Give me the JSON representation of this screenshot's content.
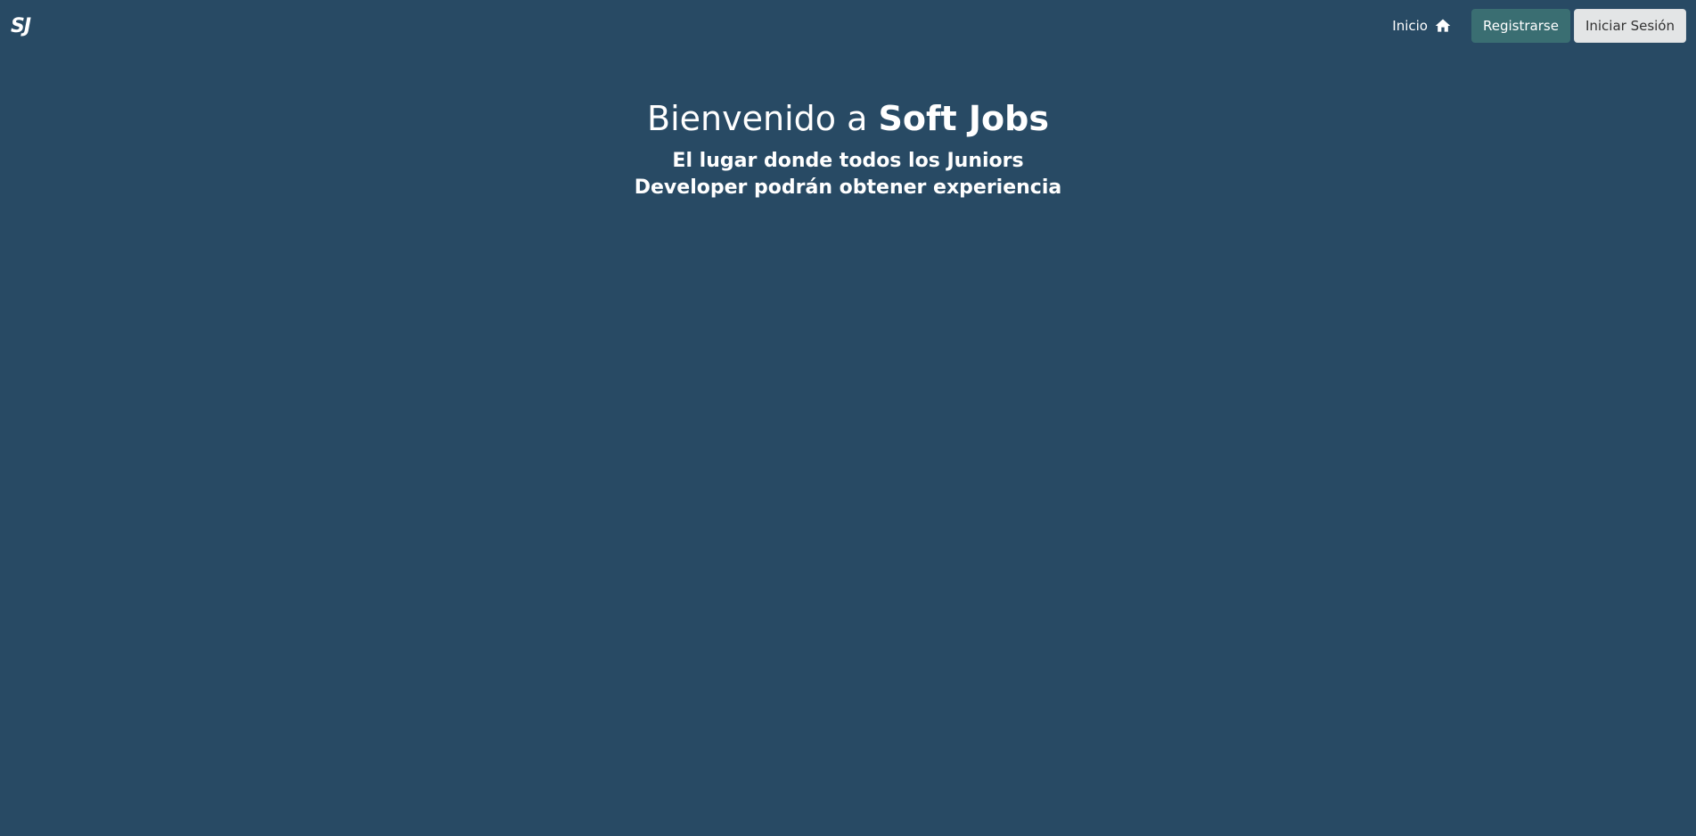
{
  "navbar": {
    "brand": "SJ",
    "home_label": "Inicio",
    "home_icon": "home-icon",
    "register_label": "Registrarse",
    "login_label": "Iniciar Sesión"
  },
  "hero": {
    "title_prefix": "Bienvenido a ",
    "title_brand": "Soft Jobs",
    "subtitle": "El lugar donde todos los Juniors Developer podrán obtener experiencia"
  },
  "colors": {
    "background": "#284a64",
    "register_button": "#3a6e72",
    "login_button": "#e3e5e6"
  }
}
